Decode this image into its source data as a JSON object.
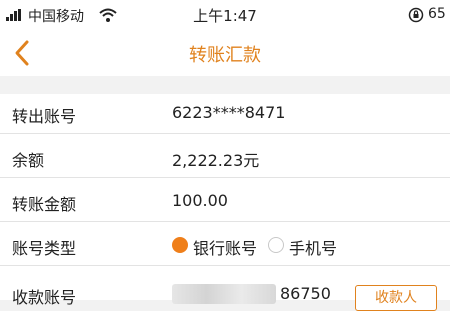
{
  "status_bar": {
    "carrier": "中国移动",
    "time": "上午1:47",
    "battery": "65",
    "icons": [
      "signal-icon",
      "wifi-icon",
      "orientation-lock-icon"
    ]
  },
  "nav": {
    "title": "转账汇款",
    "back_icon": "chevron-left-icon",
    "accent_color": "#e0821e"
  },
  "form": {
    "from_account": {
      "label": "转出账号",
      "value": "6223****8471"
    },
    "balance": {
      "label": "余额",
      "value": "2,222.23元"
    },
    "amount": {
      "label": "转账金额",
      "value": "100.00"
    },
    "account_type": {
      "label": "账号类型",
      "options": [
        {
          "label": "银行账号",
          "selected": true
        },
        {
          "label": "手机号",
          "selected": false
        }
      ]
    },
    "payee_account": {
      "label": "收款账号",
      "visible_tail": "86750",
      "button_label": "收款人"
    }
  }
}
